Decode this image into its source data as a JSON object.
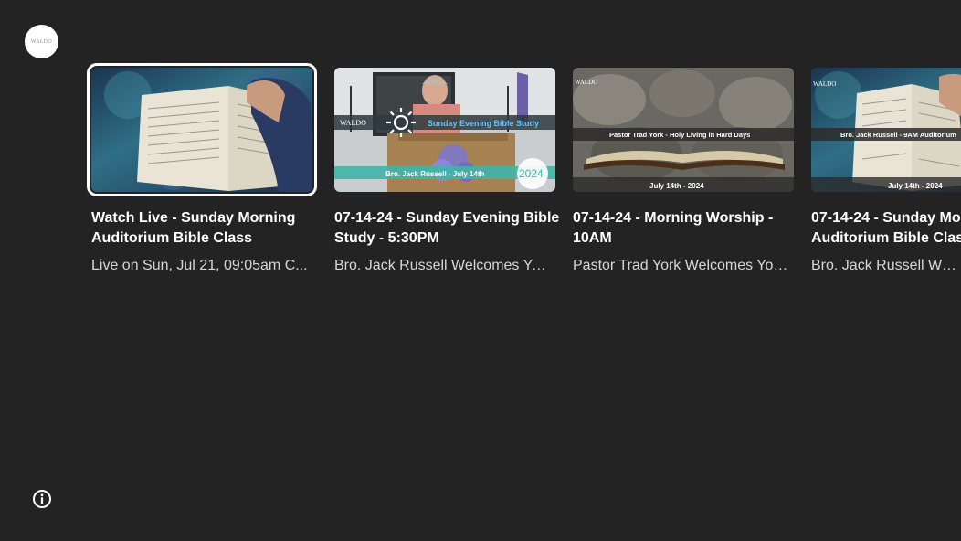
{
  "brand": {
    "logo_text": "WALDO"
  },
  "cards": [
    {
      "title": "Watch Live - Sunday Morning Auditorium Bible Class",
      "subtitle": "Live on Sun, Jul 21, 09:05am C...",
      "focused": true
    },
    {
      "title": "07-14-24 - Sunday Evening Bible Study - 5:30PM",
      "subtitle": "Bro. Jack Russell Welcomes Yo...",
      "overlay_brand": "WALDO",
      "overlay_title": "Sunday Evening Bible Study",
      "overlay_speaker": "Bro. Jack Russell - July 14th",
      "overlay_year": "2024"
    },
    {
      "title": "07-14-24 - Morning Worship - 10AM",
      "subtitle": "Pastor Trad York Welcomes You...",
      "overlay_brand": "WALDO",
      "overlay_title": "Pastor Trad York - Holy Living in Hard Days",
      "overlay_date": "July 14th - 2024"
    },
    {
      "title_line1": "07-14-24 - Sunday Mo",
      "title_line2": "Auditorium Bible Clas",
      "subtitle": "Bro. Jack Russell Welco",
      "overlay_brand": "WALDO",
      "overlay_title": "Bro. Jack Russell - 9AM Auditorium",
      "overlay_date": "July 14th - 2024"
    }
  ],
  "icons": {
    "info": "info-icon",
    "brightness": "brightness-icon"
  },
  "colors": {
    "background": "#232323",
    "focus_outline": "#ffffff",
    "subtitle": "#d6d6d6",
    "teal_banner": "#3fb5a8"
  }
}
